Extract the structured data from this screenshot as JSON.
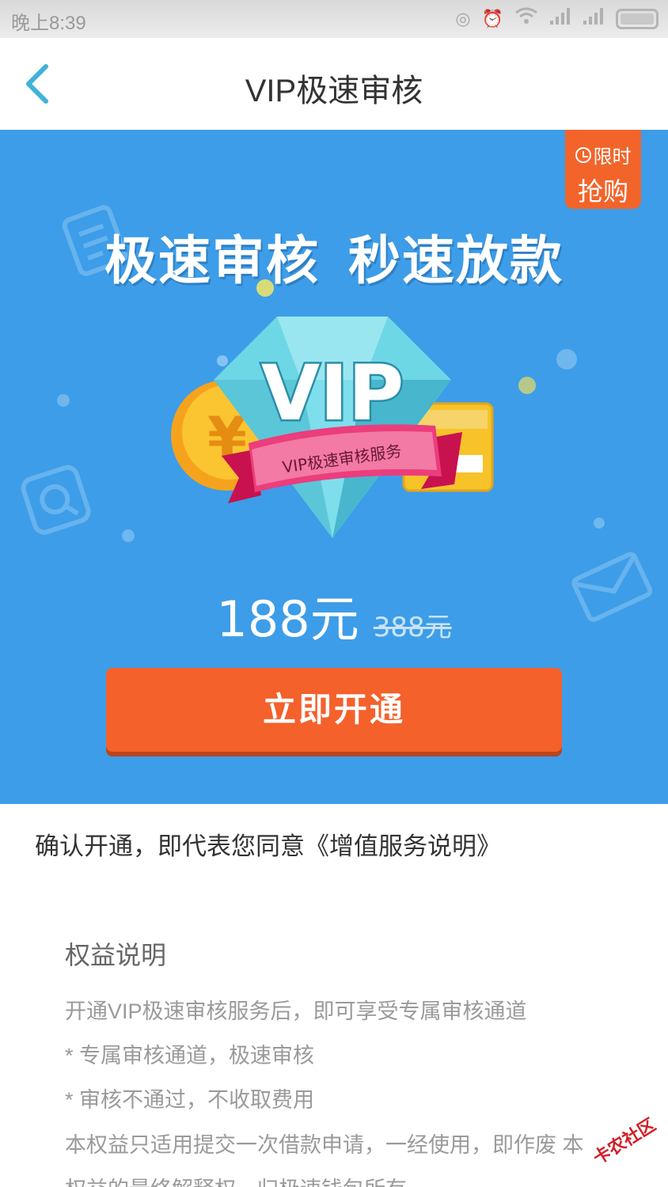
{
  "status_bar": {
    "time": "晚上8:39",
    "icons": [
      "hotspot-icon",
      "alarm-icon",
      "wifi-icon",
      "signal-icon",
      "signal-icon",
      "battery-icon"
    ]
  },
  "nav": {
    "title": "VIP极速审核",
    "back_icon": "chevron-left-icon"
  },
  "hero": {
    "background_color": "#3d9de8",
    "badge": {
      "line1": "限时",
      "line2": "抢购",
      "color": "#f2642a"
    },
    "headline_left": "极速审核",
    "headline_right": "秒速放款",
    "diamond_text": "VIP",
    "ribbon_text": "VIP极速审核服务",
    "price_now": "188元",
    "price_old": "388元",
    "button_label": "立即开通",
    "button_color": "#f4612b"
  },
  "agreement": "确认开通，即代表您同意《增值服务说明》",
  "benefits": {
    "title": "权益说明",
    "lines": [
      "开通VIP极速审核服务后，即可享受专属审核通道",
      "* 专属审核通道，极速审核",
      "* 审核不通过，不收取费用",
      "本权益只适用提交一次借款申请，一经使用，即作废 本",
      "权益的最终解释权，归极速钱包所有"
    ]
  },
  "watermark": "卡农社区"
}
